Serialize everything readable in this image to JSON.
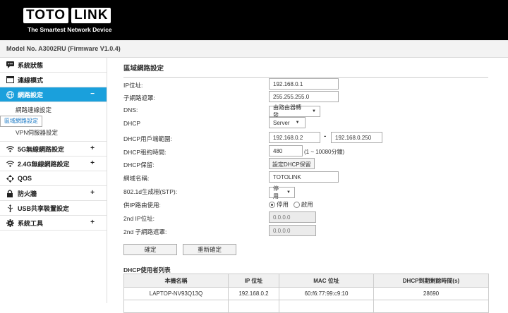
{
  "brand": {
    "logo_left": "TOTO",
    "logo_right": "LINK",
    "tagline": "The Smartest Network Device"
  },
  "model_text": "Model No. A3002RU (Firmware V1.0.4)",
  "sidebar": {
    "items": [
      {
        "label": "系統狀態",
        "toggle": ""
      },
      {
        "label": "連線模式",
        "toggle": ""
      },
      {
        "label": "網路設定",
        "toggle": "−"
      },
      {
        "label": "5G無線網路設定",
        "toggle": "+"
      },
      {
        "label": "2.4G無線網路設定",
        "toggle": "+"
      },
      {
        "label": "QOS",
        "toggle": ""
      },
      {
        "label": "防火牆",
        "toggle": "+"
      },
      {
        "label": "USB共享裝置設定",
        "toggle": ""
      },
      {
        "label": "系統工具",
        "toggle": "+"
      }
    ],
    "sub_items": [
      "網路連線設定",
      "區域網路設定",
      "VPN伺服器設定"
    ]
  },
  "main": {
    "title": "區域網路設定",
    "fields": {
      "ip_label": "IP位址:",
      "ip_value": "192.168.0.1",
      "mask_label": "子網路遮罩:",
      "mask_value": "255.255.255.0",
      "dns_label": "DNS:",
      "dns_value": "由路由器轉發",
      "dhcp_label": "DHCP",
      "dhcp_value": "Server",
      "range_label": "DHCP用戶端範圍:",
      "range_start": "192.168.0.2",
      "range_sep": "-",
      "range_end": "192.168.0.250",
      "lease_label": "DHCP租約時間:",
      "lease_value": "480",
      "lease_note": "(1 ~ 10080分鐘)",
      "reserve_label": "DHCP保留:",
      "reserve_button": "設定DHCP保留",
      "domain_label": "網域名稱:",
      "domain_value": "TOTOLINK",
      "stp_label": "802.1d生成樹(STP):",
      "stp_value": "停用",
      "bypass_label": "供IP路由使用:",
      "bypass_off": "停用",
      "bypass_on": "啟用",
      "ip2_label": "2nd IP位址:",
      "ip2_value": "0.0.0.0",
      "mask2_label": "2nd 子網路遮罩:",
      "mask2_value": "0.0.0.0"
    },
    "apply_button": "確定",
    "reset_button": "重新確定",
    "table_title": "DHCP使用者列表",
    "table_headers": [
      "本機名稱",
      "IP 位址",
      "MAC 位址",
      "DHCP到期剩餘時間(s)"
    ],
    "table_rows": [
      [
        "LAPTOP-NV93Q13Q",
        "192.168.0.2",
        "60:f6:77:99:c9:10",
        "28690"
      ]
    ]
  },
  "colors": {
    "accent": "#1aa0dc",
    "header": "#000000"
  }
}
